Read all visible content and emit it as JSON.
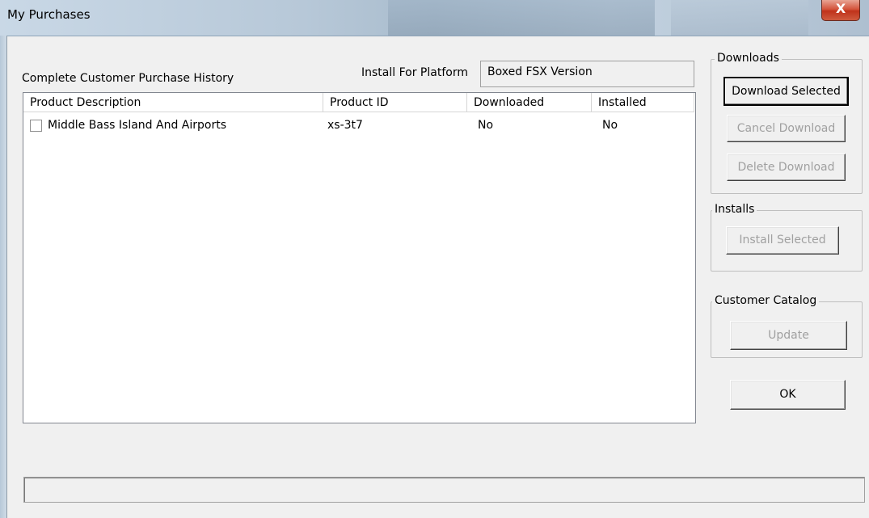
{
  "window": {
    "title": "My Purchases",
    "close_label": "X"
  },
  "history_label": "Complete Customer Purchase History",
  "platform": {
    "label": "Install For Platform",
    "value": "Boxed FSX Version"
  },
  "table": {
    "columns": [
      "Product Description",
      "Product ID",
      "Downloaded",
      "Installed"
    ],
    "rows": [
      {
        "checked": false,
        "description": "Middle Bass Island And Airports",
        "product_id": "xs-3t7",
        "downloaded": "No",
        "installed": "No"
      }
    ]
  },
  "downloads": {
    "title": "Downloads",
    "download_selected": "Download Selected",
    "cancel_download": "Cancel Download",
    "delete_download": "Delete Download"
  },
  "installs": {
    "title": "Installs",
    "install_selected": "Install Selected"
  },
  "catalog": {
    "title": "Customer Catalog",
    "update": "Update"
  },
  "ok_label": "OK",
  "status_text": ""
}
